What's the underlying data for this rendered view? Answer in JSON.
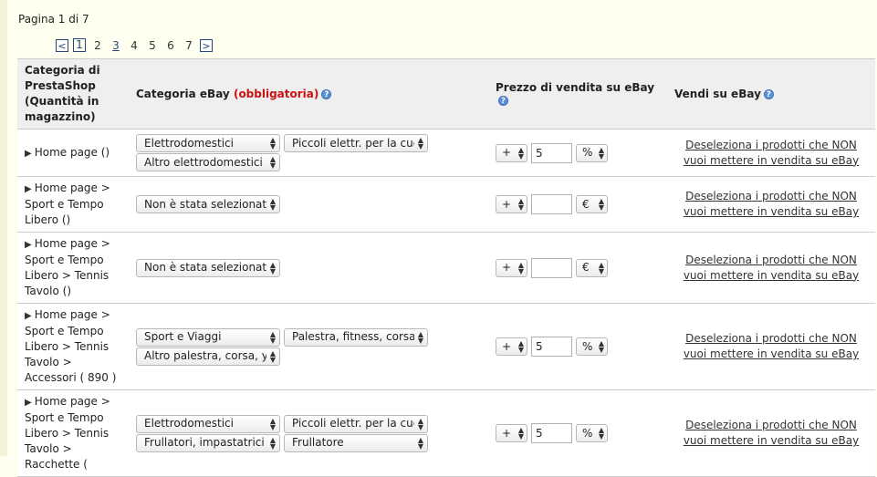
{
  "pagination": {
    "info": "Pagina 1 di 7",
    "prev": "<",
    "next": ">",
    "pages": [
      "1",
      "2",
      "3",
      "4",
      "5",
      "6",
      "7"
    ]
  },
  "table": {
    "headers": {
      "category": "Categoria di PrestaShop (Quantità in magazzino)",
      "ebay_category": "Categoria eBay",
      "required": "(obbligatoria)",
      "price": "Prezzo di vendita su eBay",
      "sell": "Vendi su eBay"
    },
    "rows": [
      {
        "category": "Home page ()",
        "selects": [
          [
            "Elettrodomestici",
            "Piccoli elettr. per la cuc"
          ],
          [
            "Altro elettrodomestici c"
          ]
        ],
        "sign": "+",
        "value": "5",
        "unit": "%",
        "link": "Deseleziona i prodotti che NON vuoi mettere in vendita su eBay"
      },
      {
        "category": "Home page > Sport e Tempo Libero ()",
        "selects": [
          [
            "Non è stata selezionata"
          ]
        ],
        "sign": "+",
        "value": "",
        "unit": "€",
        "link": "Deseleziona i prodotti che NON vuoi mettere in vendita su eBay"
      },
      {
        "category": "Home page > Sport e Tempo Libero > Tennis Tavolo ()",
        "selects": [
          [
            "Non è stata selezionata"
          ]
        ],
        "sign": "+",
        "value": "",
        "unit": "€",
        "link": "Deseleziona i prodotti che NON vuoi mettere in vendita su eBay"
      },
      {
        "category": "Home page > Sport e Tempo Libero > Tennis Tavolo > Accessori ( 890 )",
        "selects": [
          [
            "Sport e Viaggi",
            "Palestra, fitness, corsa,"
          ],
          [
            "Altro palestra, corsa, yc"
          ]
        ],
        "sign": "+",
        "value": "5",
        "unit": "%",
        "link": "Deseleziona i prodotti che NON vuoi mettere in vendita su eBay"
      },
      {
        "category": "Home page > Sport e Tempo Libero > Tennis Tavolo > Racchette (",
        "selects": [
          [
            "Elettrodomestici",
            "Piccoli elettr. per la cuc"
          ],
          [
            "Frullatori, impastatrici",
            "Frullatore"
          ]
        ],
        "sign": "+",
        "value": "5",
        "unit": "%",
        "link": "Deseleziona i prodotti che NON vuoi mettere in vendita su eBay"
      }
    ]
  },
  "colors": {
    "link": "#26497a",
    "required": "#cc1111",
    "header_bg": "#efefef",
    "page_bg": "#fffff0"
  }
}
